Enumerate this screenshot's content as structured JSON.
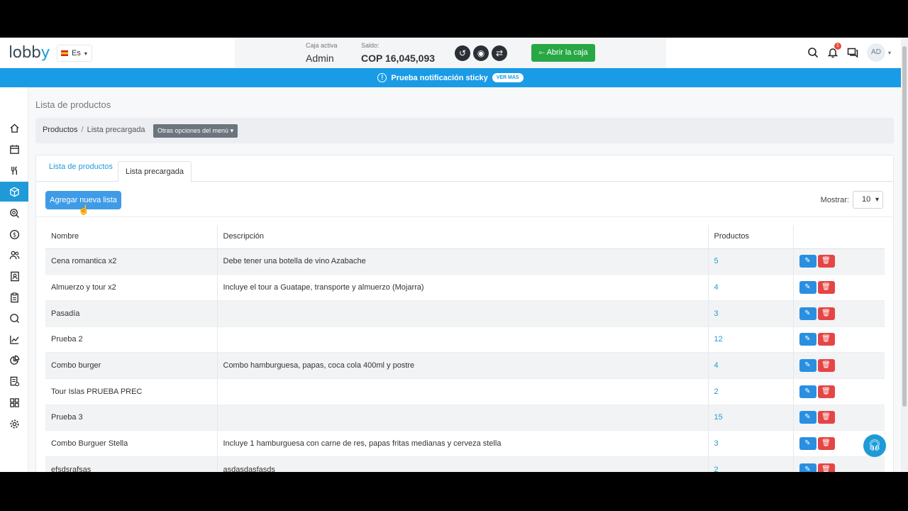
{
  "topbar": {
    "logo_main": "lobb",
    "logo_accent": "y",
    "lang": "Es",
    "caja_label": "Caja activa",
    "caja_value": "Admin",
    "saldo_label": "Saldo:",
    "saldo_value": "COP 16,045,093",
    "abrir_label": "⟜ Abrir la caja",
    "notif_count": "1",
    "avatar": "AD"
  },
  "banner": {
    "text": "Prueba notificación sticky",
    "button": "VER MÁS"
  },
  "page": {
    "title": "Lista de productos",
    "crumb_1": "Productos",
    "crumb_sep": "/",
    "crumb_2": "Lista precargada",
    "options_label": "Otras opciones del menú"
  },
  "tabs": [
    "Lista de productos",
    "Lista precargada"
  ],
  "toolbar": {
    "add_label": "Agregar nueva lista",
    "show_label": "Mostrar:",
    "show_value": "10"
  },
  "table": {
    "headers": [
      "Nombre",
      "Descripción",
      "Productos",
      ""
    ],
    "rows": [
      {
        "name": "Cena romantica x2",
        "desc": "Debe tener una botella de vino Azabache",
        "count": "5"
      },
      {
        "name": "Almuerzo y tour x2",
        "desc": "Incluye el tour a Guatape, transporte y almuerzo (Mojarra)",
        "count": "4"
      },
      {
        "name": "Pasadía",
        "desc": "",
        "count": "3"
      },
      {
        "name": "Prueba 2",
        "desc": "",
        "count": "12"
      },
      {
        "name": "Combo burger",
        "desc": "Combo hamburguesa, papas, coca cola 400ml y postre",
        "count": "4"
      },
      {
        "name": "Tour Islas PRUEBA PREC",
        "desc": "",
        "count": "2"
      },
      {
        "name": "Prueba 3",
        "desc": "",
        "count": "15"
      },
      {
        "name": "Combo Burguer Stella",
        "desc": "Incluye 1 hamburguesa con carne de res, papas fritas medianas y cerveza stella",
        "count": "3"
      },
      {
        "name": "efsdsrafsas",
        "desc": "asdasdasfasds",
        "count": "2"
      }
    ]
  },
  "colors": {
    "brand": "#1e9bd7",
    "success": "#27a844",
    "danger": "#e64545"
  },
  "sidebar_icons": [
    "home-icon",
    "calendar-icon",
    "fork-knife-icon",
    "box-icon",
    "location-search-icon",
    "money-icon",
    "users-icon",
    "address-book-icon",
    "clipboard-icon",
    "search-icon",
    "chart-line-icon",
    "pie-chart-icon",
    "report-icon",
    "grid-icon",
    "gear-icon"
  ]
}
